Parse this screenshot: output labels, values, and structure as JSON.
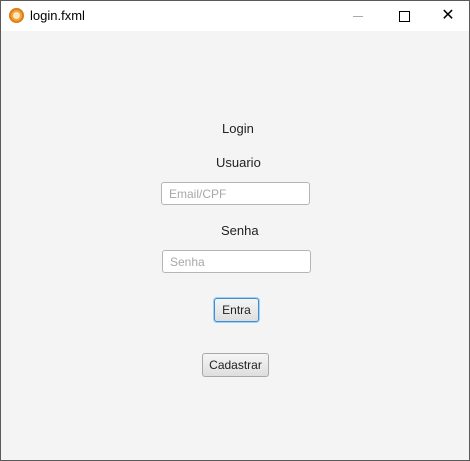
{
  "window": {
    "title": "login.fxml",
    "controls": {
      "minimize": "—",
      "maximize": "",
      "close": "✕"
    }
  },
  "form": {
    "heading": "Login",
    "user_label": "Usuario",
    "user_placeholder": "Email/CPF",
    "user_value": "",
    "password_label": "Senha",
    "password_placeholder": "Senha",
    "password_value": "",
    "submit_label": "Entra",
    "register_label": "Cadastrar"
  },
  "icons": {
    "app": "app-logo-icon",
    "minimize": "minimize-icon",
    "maximize": "maximize-icon",
    "close": "close-icon"
  },
  "colors": {
    "focus_border": "#3c8fd6",
    "background": "#f4f4f4"
  }
}
